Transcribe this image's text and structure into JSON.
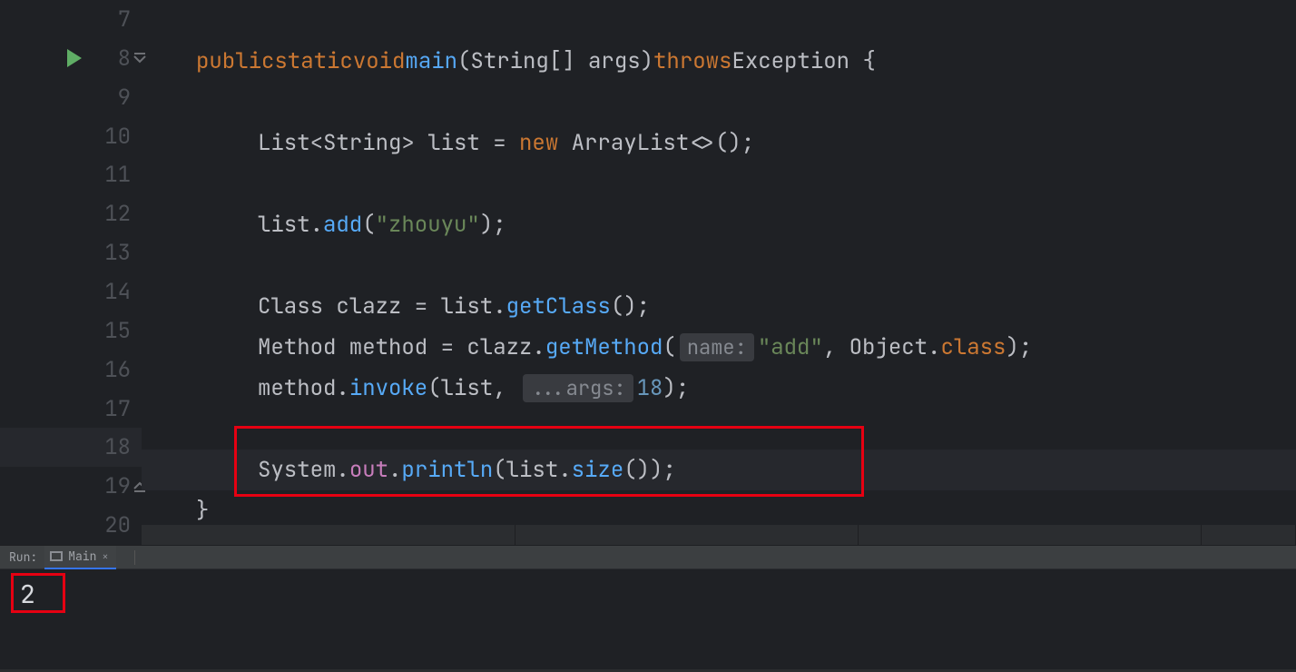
{
  "lines": {
    "start": 7,
    "end": 20
  },
  "code": {
    "l8": {
      "kw_public": "public",
      "kw_static": "static",
      "kw_void": "void",
      "fn_main": "main",
      "args": "(String[] args)",
      "kw_throws": "throws",
      "exc": "Exception",
      "brace": " {"
    },
    "l10": {
      "type1": "List",
      "generic": "<String>",
      "var": " list = ",
      "kw_new": "new",
      "type2": " ArrayList",
      "tail": "<>();"
    },
    "l12": {
      "pre": "list.",
      "fn": "add",
      "args": "(",
      "str": "\"zhouyu\"",
      "end": ");"
    },
    "l14": {
      "pre": "Class clazz = list.",
      "fn": "getClass",
      "end": "();"
    },
    "l15": {
      "pre": "Method method = clazz.",
      "fn": "getMethod",
      "open": "(",
      "hint": "name:",
      "str": "\"add\"",
      "mid": ", Object.",
      "kw": "class",
      "end": ");"
    },
    "l16": {
      "pre": "method.",
      "fn": "invoke",
      "open": "(list, ",
      "hint": "...args:",
      "num": "18",
      "end": ");"
    },
    "l18": {
      "pre": "System.",
      "field": "out",
      "dot": ".",
      "fn": "println",
      "open": "(list.",
      "fn2": "size",
      "end": "());"
    },
    "l19": "}"
  },
  "runPanel": {
    "label": "Run:",
    "tabName": "Main",
    "output": "2"
  }
}
